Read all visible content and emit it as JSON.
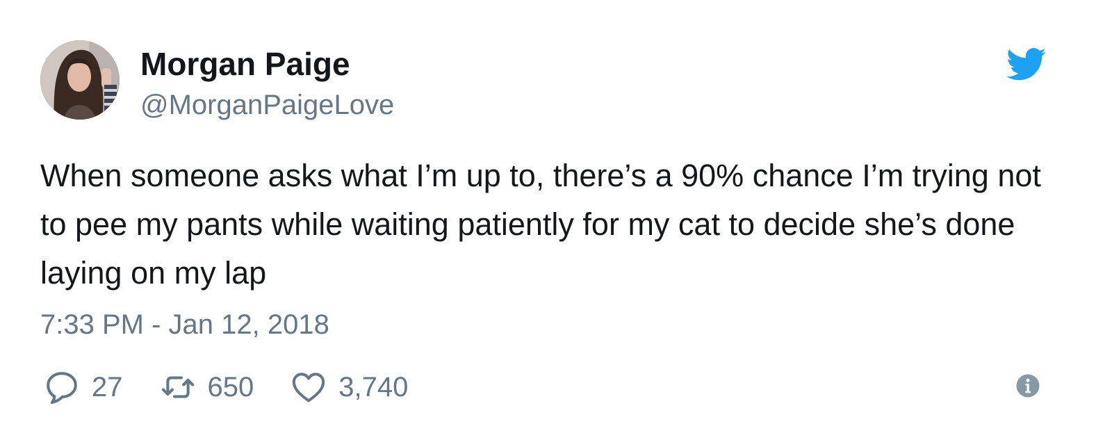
{
  "author": {
    "display_name": "Morgan Paige",
    "handle": "@MorganPaigeLove"
  },
  "tweet": {
    "text": "When someone asks what I’m up to, there’s a 90% chance I’m trying not to pee my pants while waiting patiently for my cat to decide she’s done laying on my lap",
    "timestamp": "7:33 PM - Jan 12, 2018"
  },
  "actions": {
    "replies": "27",
    "retweets": "650",
    "likes": "3,740"
  },
  "icons": {
    "brand": "twitter-bird-icon",
    "reply": "reply-bubble-icon",
    "retweet": "retweet-icon",
    "like": "heart-icon",
    "info": "info-icon"
  },
  "colors": {
    "text": "#14171a",
    "secondary": "#657786",
    "brand_blue": "#1da1f2"
  }
}
